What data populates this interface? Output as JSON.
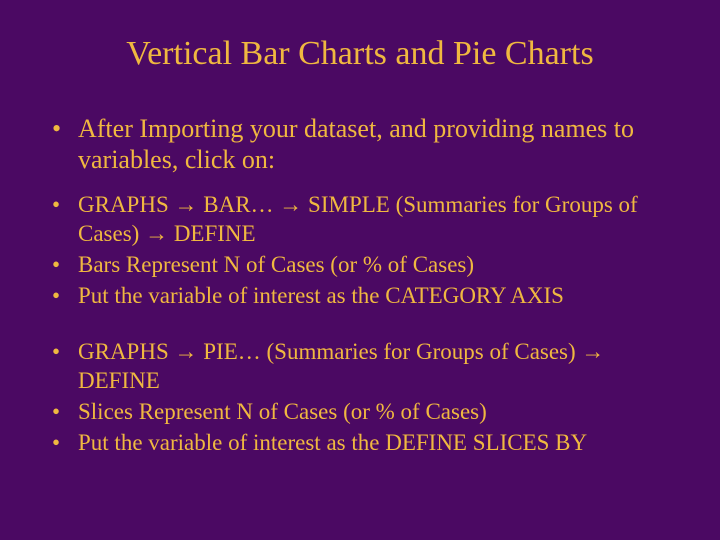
{
  "title": "Vertical Bar Charts and Pie Charts",
  "intro": "After Importing your dataset, and providing names to variables, click on:",
  "group1": {
    "b1": "GRAPHS → BAR… → SIMPLE (Summaries for Groups of Cases) → DEFINE",
    "b2": "Bars Represent N of Cases (or % of Cases)",
    "b3": "Put the variable of interest as the CATEGORY AXIS"
  },
  "group2": {
    "b1": "GRAPHS → PIE… (Summaries for Groups of Cases) → DEFINE",
    "b2": "Slices Represent N of Cases (or % of Cases)",
    "b3": "Put the variable of interest as the DEFINE SLICES BY"
  }
}
